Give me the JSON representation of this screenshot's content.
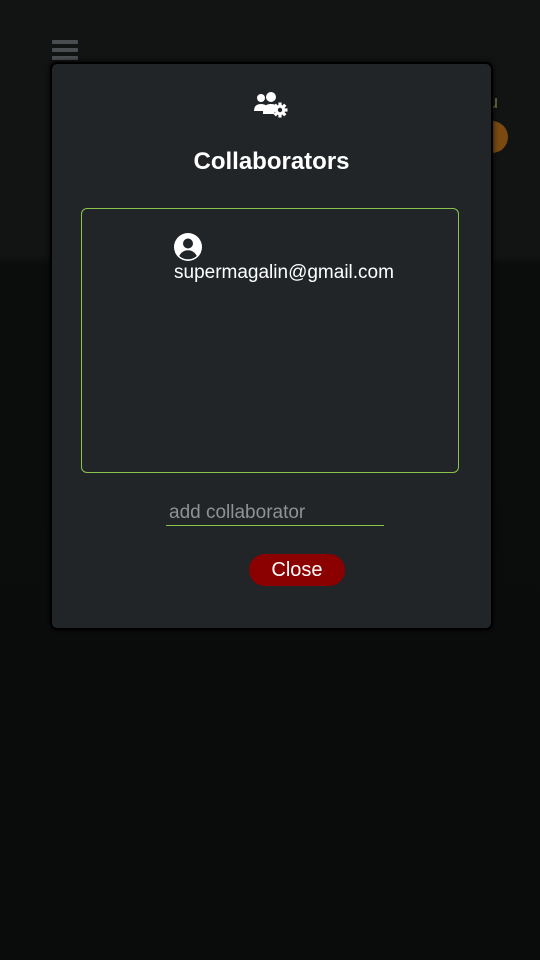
{
  "background": {
    "tab_partial_text": "u",
    "colors": {
      "tab_text": "#6c7d3a",
      "avatar": "#7a4a10"
    },
    "icons": [
      "hamburger-menu-icon"
    ]
  },
  "modal": {
    "icon": "users-gear-icon",
    "title": "Collaborators",
    "collaborators": [
      {
        "icon": "user-circle-icon",
        "email": "supermagalin@gmail.com"
      }
    ],
    "add_input": {
      "placeholder": "add collaborator",
      "value": ""
    },
    "close_label": "Close"
  },
  "colors": {
    "modal_background": "#212528",
    "accent_border": "#8bc34a",
    "close_button": "#8b0000",
    "text": "#ffffff"
  }
}
